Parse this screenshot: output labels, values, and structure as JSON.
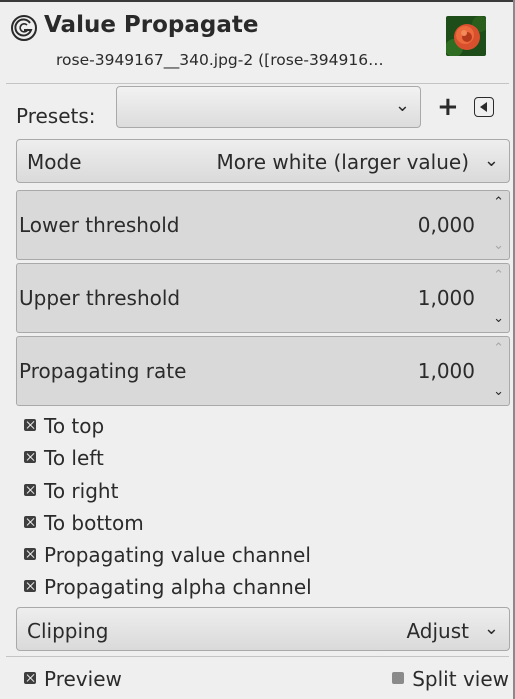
{
  "header": {
    "title": "Value Propagate",
    "subtitle": "rose-3949167__340.jpg-2 ([rose-394916…",
    "icon": "gimp-gegl-icon",
    "thumbnail": "rose-image-thumbnail"
  },
  "presets": {
    "label": "Presets:",
    "value": "",
    "add_label": "+",
    "menu_icon": "menu-triangle-icon"
  },
  "mode": {
    "label": "Mode",
    "value": "More white (larger value)"
  },
  "spin": {
    "lower": {
      "label": "Lower threshold",
      "value": "0,000"
    },
    "upper": {
      "label": "Upper threshold",
      "value": "1,000"
    },
    "rate": {
      "label": "Propagating rate",
      "value": "1,000"
    }
  },
  "checks": {
    "to_top": "To top",
    "to_left": "To left",
    "to_right": "To right",
    "to_bottom": "To bottom",
    "value_channel": "Propagating value channel",
    "alpha_channel": "Propagating alpha channel"
  },
  "clipping": {
    "label": "Clipping",
    "value": "Adjust"
  },
  "footer": {
    "preview": "Preview",
    "split_view": "Split view"
  },
  "colors": {
    "background": "#efefef",
    "text": "#2b2b2b",
    "field": "#d9d9d9"
  }
}
